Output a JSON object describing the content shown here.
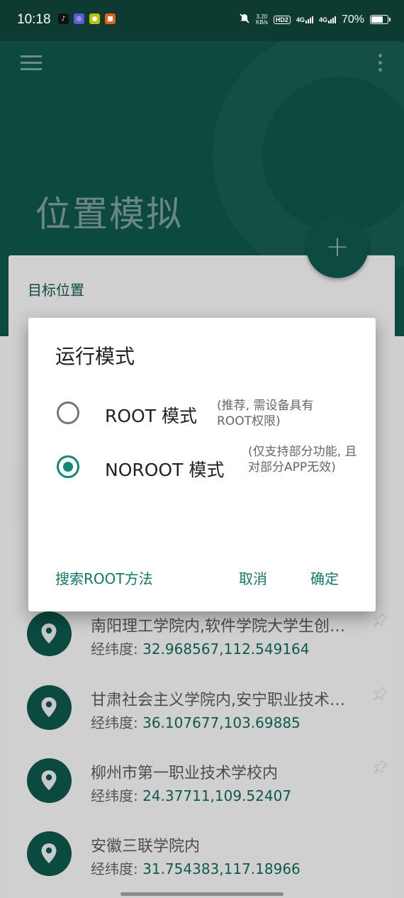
{
  "status_bar": {
    "time": "10:18",
    "speed_value": "3.20",
    "speed_unit": "KB/s",
    "hd_badge": "HD2",
    "net1": "4G",
    "net2": "4G",
    "battery": "70%"
  },
  "header": {
    "title": "位置模拟"
  },
  "target_card": {
    "label": "目标位置",
    "fab": "+"
  },
  "history": {
    "coord_label": "经纬度:",
    "items": [
      {
        "name": "南阳理工学院内,软件学院大学生创新创业孵化园",
        "coords": "32.968567,112.549164"
      },
      {
        "name": "甘肃社会主义学院内,安宁职业技术学院",
        "coords": "36.107677,103.69885"
      },
      {
        "name": "柳州市第一职业技术学校内",
        "coords": "24.37711,109.52407"
      },
      {
        "name": "安徽三联学院内",
        "coords": "31.754383,117.18966"
      }
    ]
  },
  "dialog": {
    "title": "运行模式",
    "options": [
      {
        "label": "ROOT 模式",
        "desc": "(推荐, 需设备具有ROOT权限)",
        "checked": false
      },
      {
        "label": "NOROOT 模式",
        "desc": "(仅支持部分功能, 且对部分APP无效)",
        "checked": true
      }
    ],
    "search_root": "搜索ROOT方法",
    "cancel": "取消",
    "confirm": "确定"
  },
  "colors": {
    "primary": "#0d7a66",
    "primary_dark": "#0c4a3f",
    "status_bar": "#0d3a31"
  }
}
